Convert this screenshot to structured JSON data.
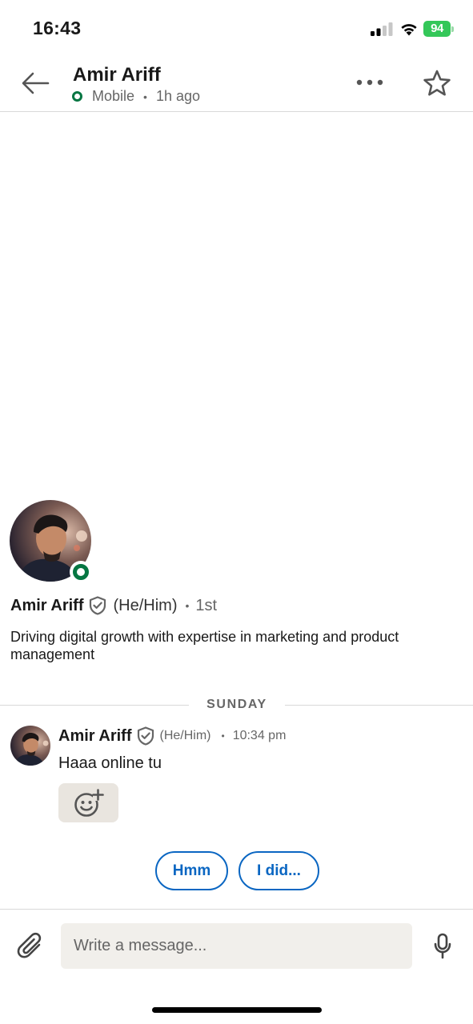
{
  "status_bar": {
    "time": "16:43",
    "battery_level": "94",
    "battery_color": "#34c759",
    "icons": [
      "signal-icon",
      "wifi-icon",
      "battery-icon"
    ]
  },
  "header": {
    "name": "Amir Ariff",
    "presence_label": "Mobile",
    "separator": "•",
    "last_active": "1h ago",
    "icons": [
      "back-arrow-icon",
      "more-options-icon",
      "star-icon"
    ]
  },
  "profile": {
    "name": "Amir Ariff",
    "pronouns": "(He/Him)",
    "separator": "•",
    "degree": "1st",
    "headline": "Driving digital growth with expertise in marketing and product management",
    "online_status": "online",
    "presence_color": "#057642"
  },
  "conversation": {
    "day_label": "SUNDAY",
    "messages": [
      {
        "sender": "Amir Ariff",
        "pronouns": "(He/Him)",
        "separator": "•",
        "time": "10:34 pm",
        "text": "Haaa online tu"
      }
    ]
  },
  "smart_replies": [
    "Hmm",
    "I did..."
  ],
  "composer": {
    "placeholder": "Write a message...",
    "value": "",
    "icons": [
      "paperclip-icon",
      "microphone-icon"
    ]
  },
  "colors": {
    "accent": "#0a66c2",
    "presence": "#057642",
    "input_bg": "#f1efeb",
    "reaction_bg": "#e9e5df"
  }
}
